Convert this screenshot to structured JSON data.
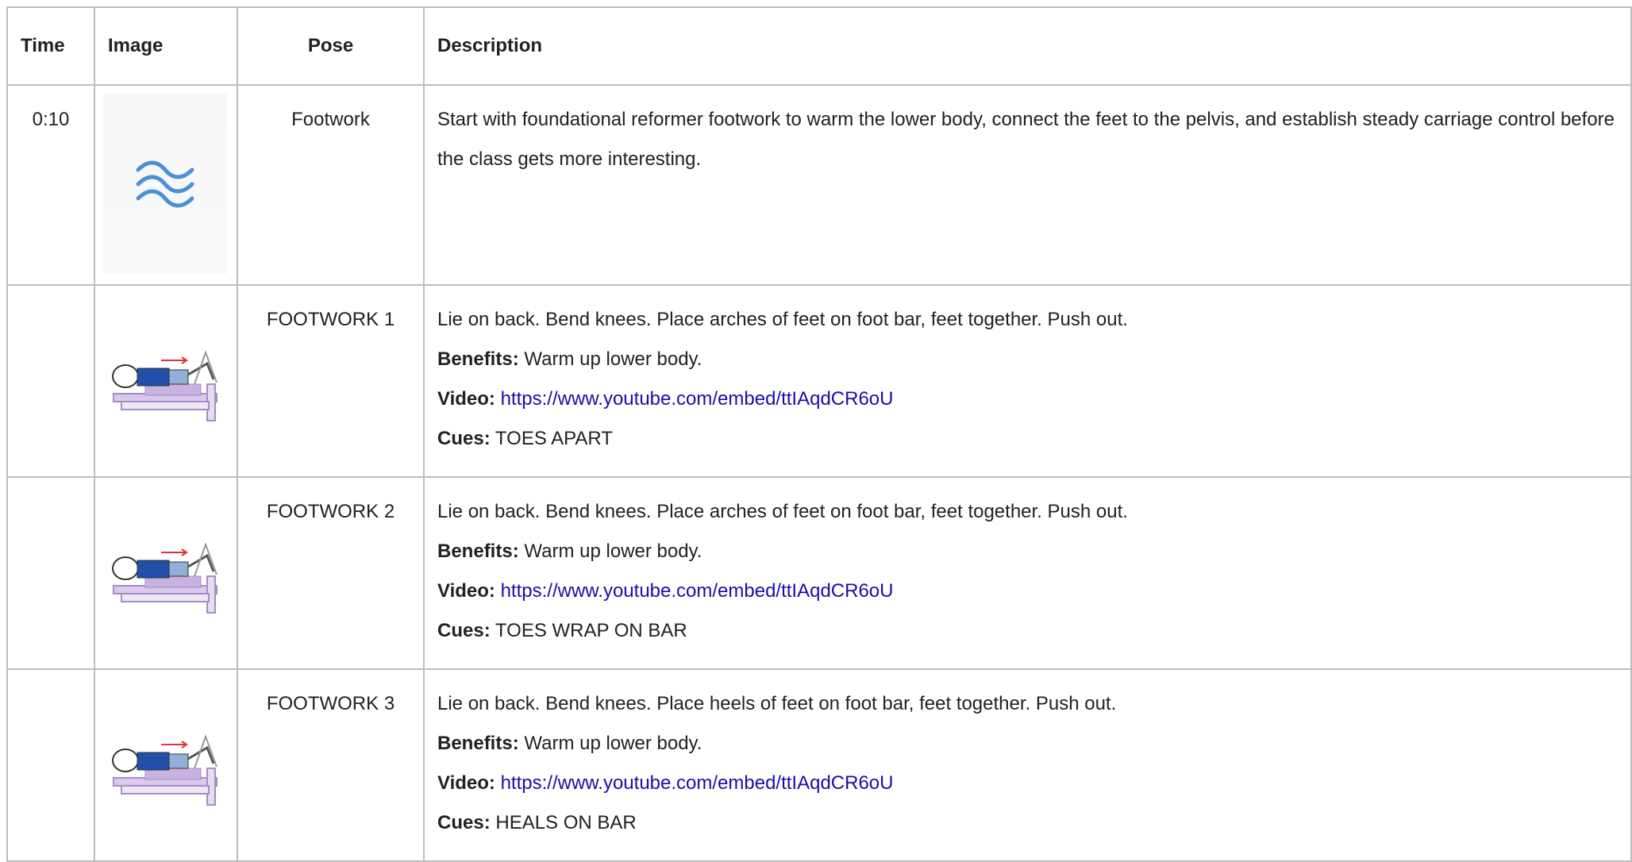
{
  "table": {
    "headers": [
      "Time",
      "Image",
      "Pose",
      "Description"
    ],
    "rows": [
      {
        "time": "0:10",
        "image_icon": "wave-icon",
        "pose": "Footwork",
        "description": "Start with foundational reformer footwork to warm the lower body, connect the feet to the pelvis, and establish steady carriage control before the class gets more interesting."
      },
      {
        "time": "",
        "image_icon": "reformer-footwork-illustration",
        "pose": "FOOTWORK 1",
        "description": "Lie on back. Bend knees. Place arches of feet on foot bar, feet together. Push out.",
        "benefits_label": "Benefits:",
        "benefits": "Warm up lower body.",
        "video_label": "Video:",
        "video_url": "https://www.youtube.com/embed/ttIAqdCR6oU",
        "cues_label": "Cues:",
        "cues": "TOES APART"
      },
      {
        "time": "",
        "image_icon": "reformer-footwork-illustration",
        "pose": "FOOTWORK 2",
        "description": "Lie on back. Bend knees. Place arches of feet on foot bar, feet together. Push out.",
        "benefits_label": "Benefits:",
        "benefits": "Warm up lower body.",
        "video_label": "Video:",
        "video_url": "https://www.youtube.com/embed/ttIAqdCR6oU",
        "cues_label": "Cues:",
        "cues": "TOES WRAP ON BAR"
      },
      {
        "time": "",
        "image_icon": "reformer-footwork-illustration",
        "pose": "FOOTWORK 3",
        "description": "Lie on back. Bend knees. Place heels of feet on foot bar, feet together. Push out.",
        "benefits_label": "Benefits:",
        "benefits": "Warm up lower body.",
        "video_label": "Video:",
        "video_url": "https://www.youtube.com/embed/ttIAqdCR6oU",
        "cues_label": "Cues:",
        "cues": "HEALS ON BAR"
      }
    ]
  },
  "colors": {
    "link": "#1a0dab",
    "wave": "#4a90d9",
    "reformer": "#b9a3d6",
    "body_blue": "#1f4fa8",
    "border": "#bdbdbd"
  }
}
